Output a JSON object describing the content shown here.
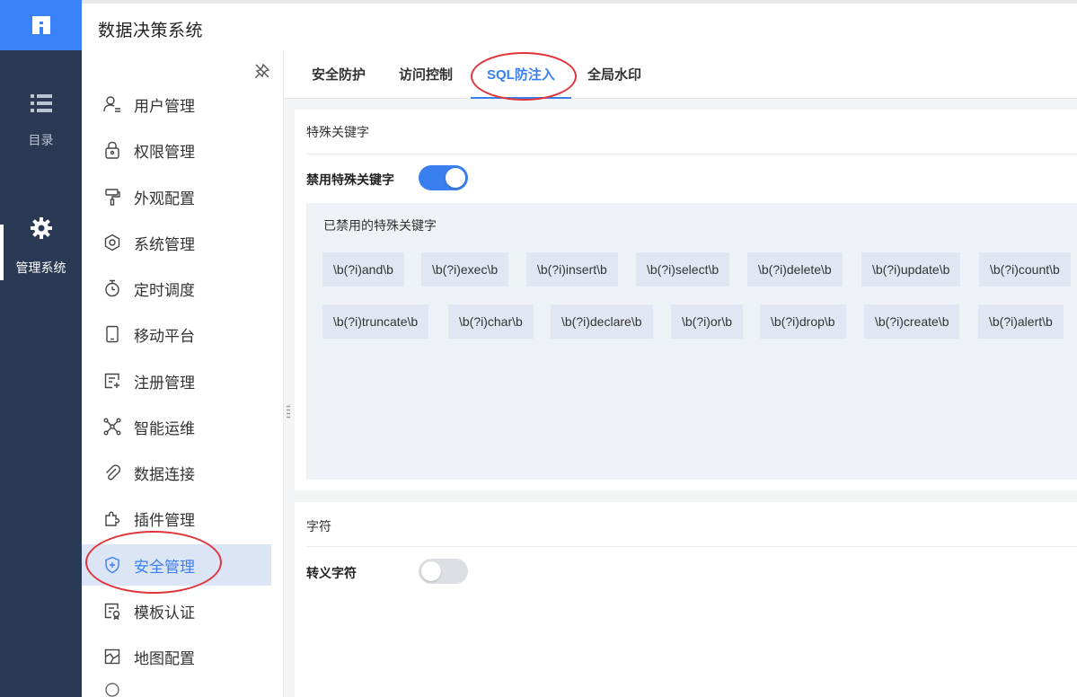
{
  "app": {
    "title": "数据决策系统"
  },
  "rail": {
    "items": [
      {
        "label": "目录",
        "icon": "list-icon"
      },
      {
        "label": "管理系统",
        "icon": "gear-icon"
      }
    ]
  },
  "menu": {
    "items": [
      {
        "label": "用户管理",
        "icon": "user-icon"
      },
      {
        "label": "权限管理",
        "icon": "lock-icon"
      },
      {
        "label": "外观配置",
        "icon": "paint-roller-icon"
      },
      {
        "label": "系统管理",
        "icon": "settings-icon"
      },
      {
        "label": "定时调度",
        "icon": "stopwatch-icon"
      },
      {
        "label": "移动平台",
        "icon": "tablet-icon"
      },
      {
        "label": "注册管理",
        "icon": "register-icon"
      },
      {
        "label": "智能运维",
        "icon": "network-icon"
      },
      {
        "label": "数据连接",
        "icon": "paperclip-icon"
      },
      {
        "label": "插件管理",
        "icon": "puzzle-icon"
      },
      {
        "label": "安全管理",
        "icon": "shield-icon"
      },
      {
        "label": "模板认证",
        "icon": "certificate-icon"
      },
      {
        "label": "地图配置",
        "icon": "map-icon"
      }
    ],
    "active_index": 10
  },
  "tabs": {
    "items": [
      "安全防护",
      "访问控制",
      "SQL防注入",
      "全局水印"
    ],
    "active_index": 2
  },
  "keywords_card": {
    "title": "特殊关键字",
    "toggle_label": "禁用特殊关键字",
    "toggle_on": true,
    "panel_title": "已禁用的特殊关键字",
    "chips_row1": [
      "\\b(?i)and\\b",
      "\\b(?i)exec\\b",
      "\\b(?i)insert\\b",
      "\\b(?i)select\\b",
      "\\b(?i)delete\\b",
      "\\b(?i)update\\b",
      "\\b(?i)count\\b"
    ],
    "chips_row2": [
      "\\b(?i)truncate\\b",
      "\\b(?i)char\\b",
      "\\b(?i)declare\\b",
      "\\b(?i)or\\b",
      "\\b(?i)drop\\b",
      "\\b(?i)create\\b",
      "\\b(?i)alert\\b"
    ]
  },
  "chars_card": {
    "title": "字符",
    "toggle_label": "转义字符",
    "toggle_on": false
  },
  "colors": {
    "accent": "#3a7ff0",
    "rail_bg": "#2a3a55",
    "logo_bg": "#3a82f7",
    "annotation": "#e0353b"
  }
}
